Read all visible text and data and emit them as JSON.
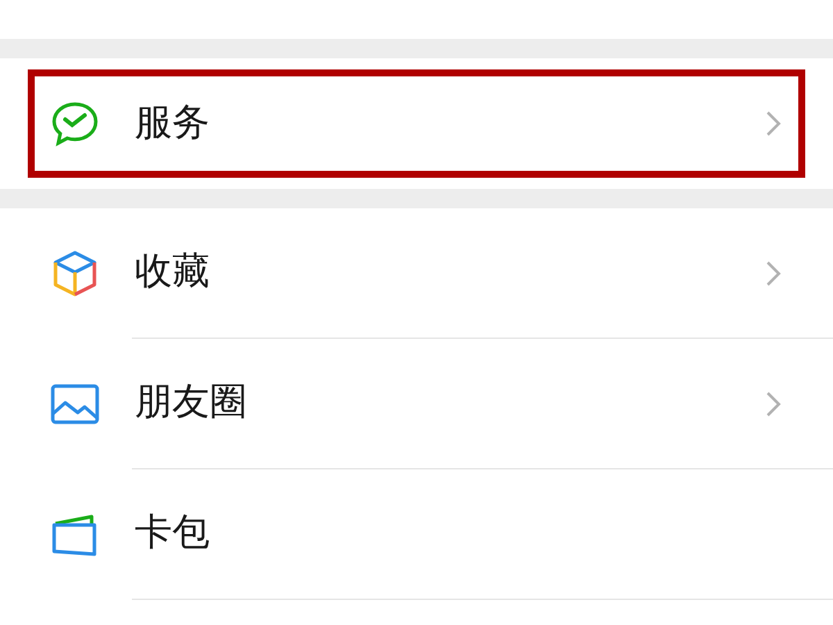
{
  "groups": [
    {
      "items": [
        {
          "kind": "services",
          "label": "服务",
          "chevron": true,
          "highlighted": true
        }
      ]
    },
    {
      "items": [
        {
          "kind": "favorites",
          "label": "收藏",
          "chevron": true,
          "highlighted": false
        },
        {
          "kind": "moments",
          "label": "朋友圈",
          "chevron": true,
          "highlighted": false
        },
        {
          "kind": "cards",
          "label": "卡包",
          "chevron": false,
          "highlighted": false
        }
      ]
    }
  ]
}
